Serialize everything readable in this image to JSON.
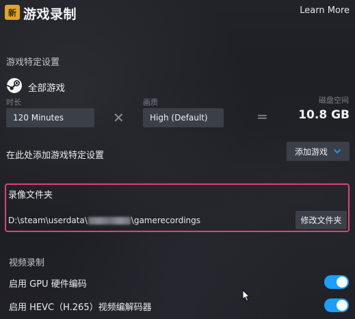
{
  "header": {
    "app_icon_text": "新",
    "title": "游戏录制",
    "learn_more": "Learn More"
  },
  "game_settings": {
    "heading": "游戏特定设置",
    "game_icon": "steam-icon",
    "game_name": "全部游戏",
    "duration_label": "时长",
    "duration_value": "120 Minutes",
    "multiply_symbol": "✕",
    "quality_label": "画质",
    "quality_value": "High (Default)",
    "equals_symbol": "=",
    "disk_label": "磁盘空间",
    "disk_value": "10.8 GB",
    "add_settings_label": "在此处添加游戏特定设置",
    "add_game_button": "添加游戏"
  },
  "recording_folder": {
    "title": "录像文件夹",
    "path_prefix": "D:\\steam\\userdata\\",
    "path_suffix": "\\gamerecordings",
    "change_button": "修改文件夹",
    "highlight_color": "#e0417a"
  },
  "video": {
    "heading": "视频录制",
    "toggles": [
      {
        "label": "启用 GPU 硬件编码",
        "enabled": true
      },
      {
        "label": "启用 HEVC（H.265）视频编解码器",
        "enabled": true
      }
    ],
    "toggle_color": "#1a9fff"
  }
}
